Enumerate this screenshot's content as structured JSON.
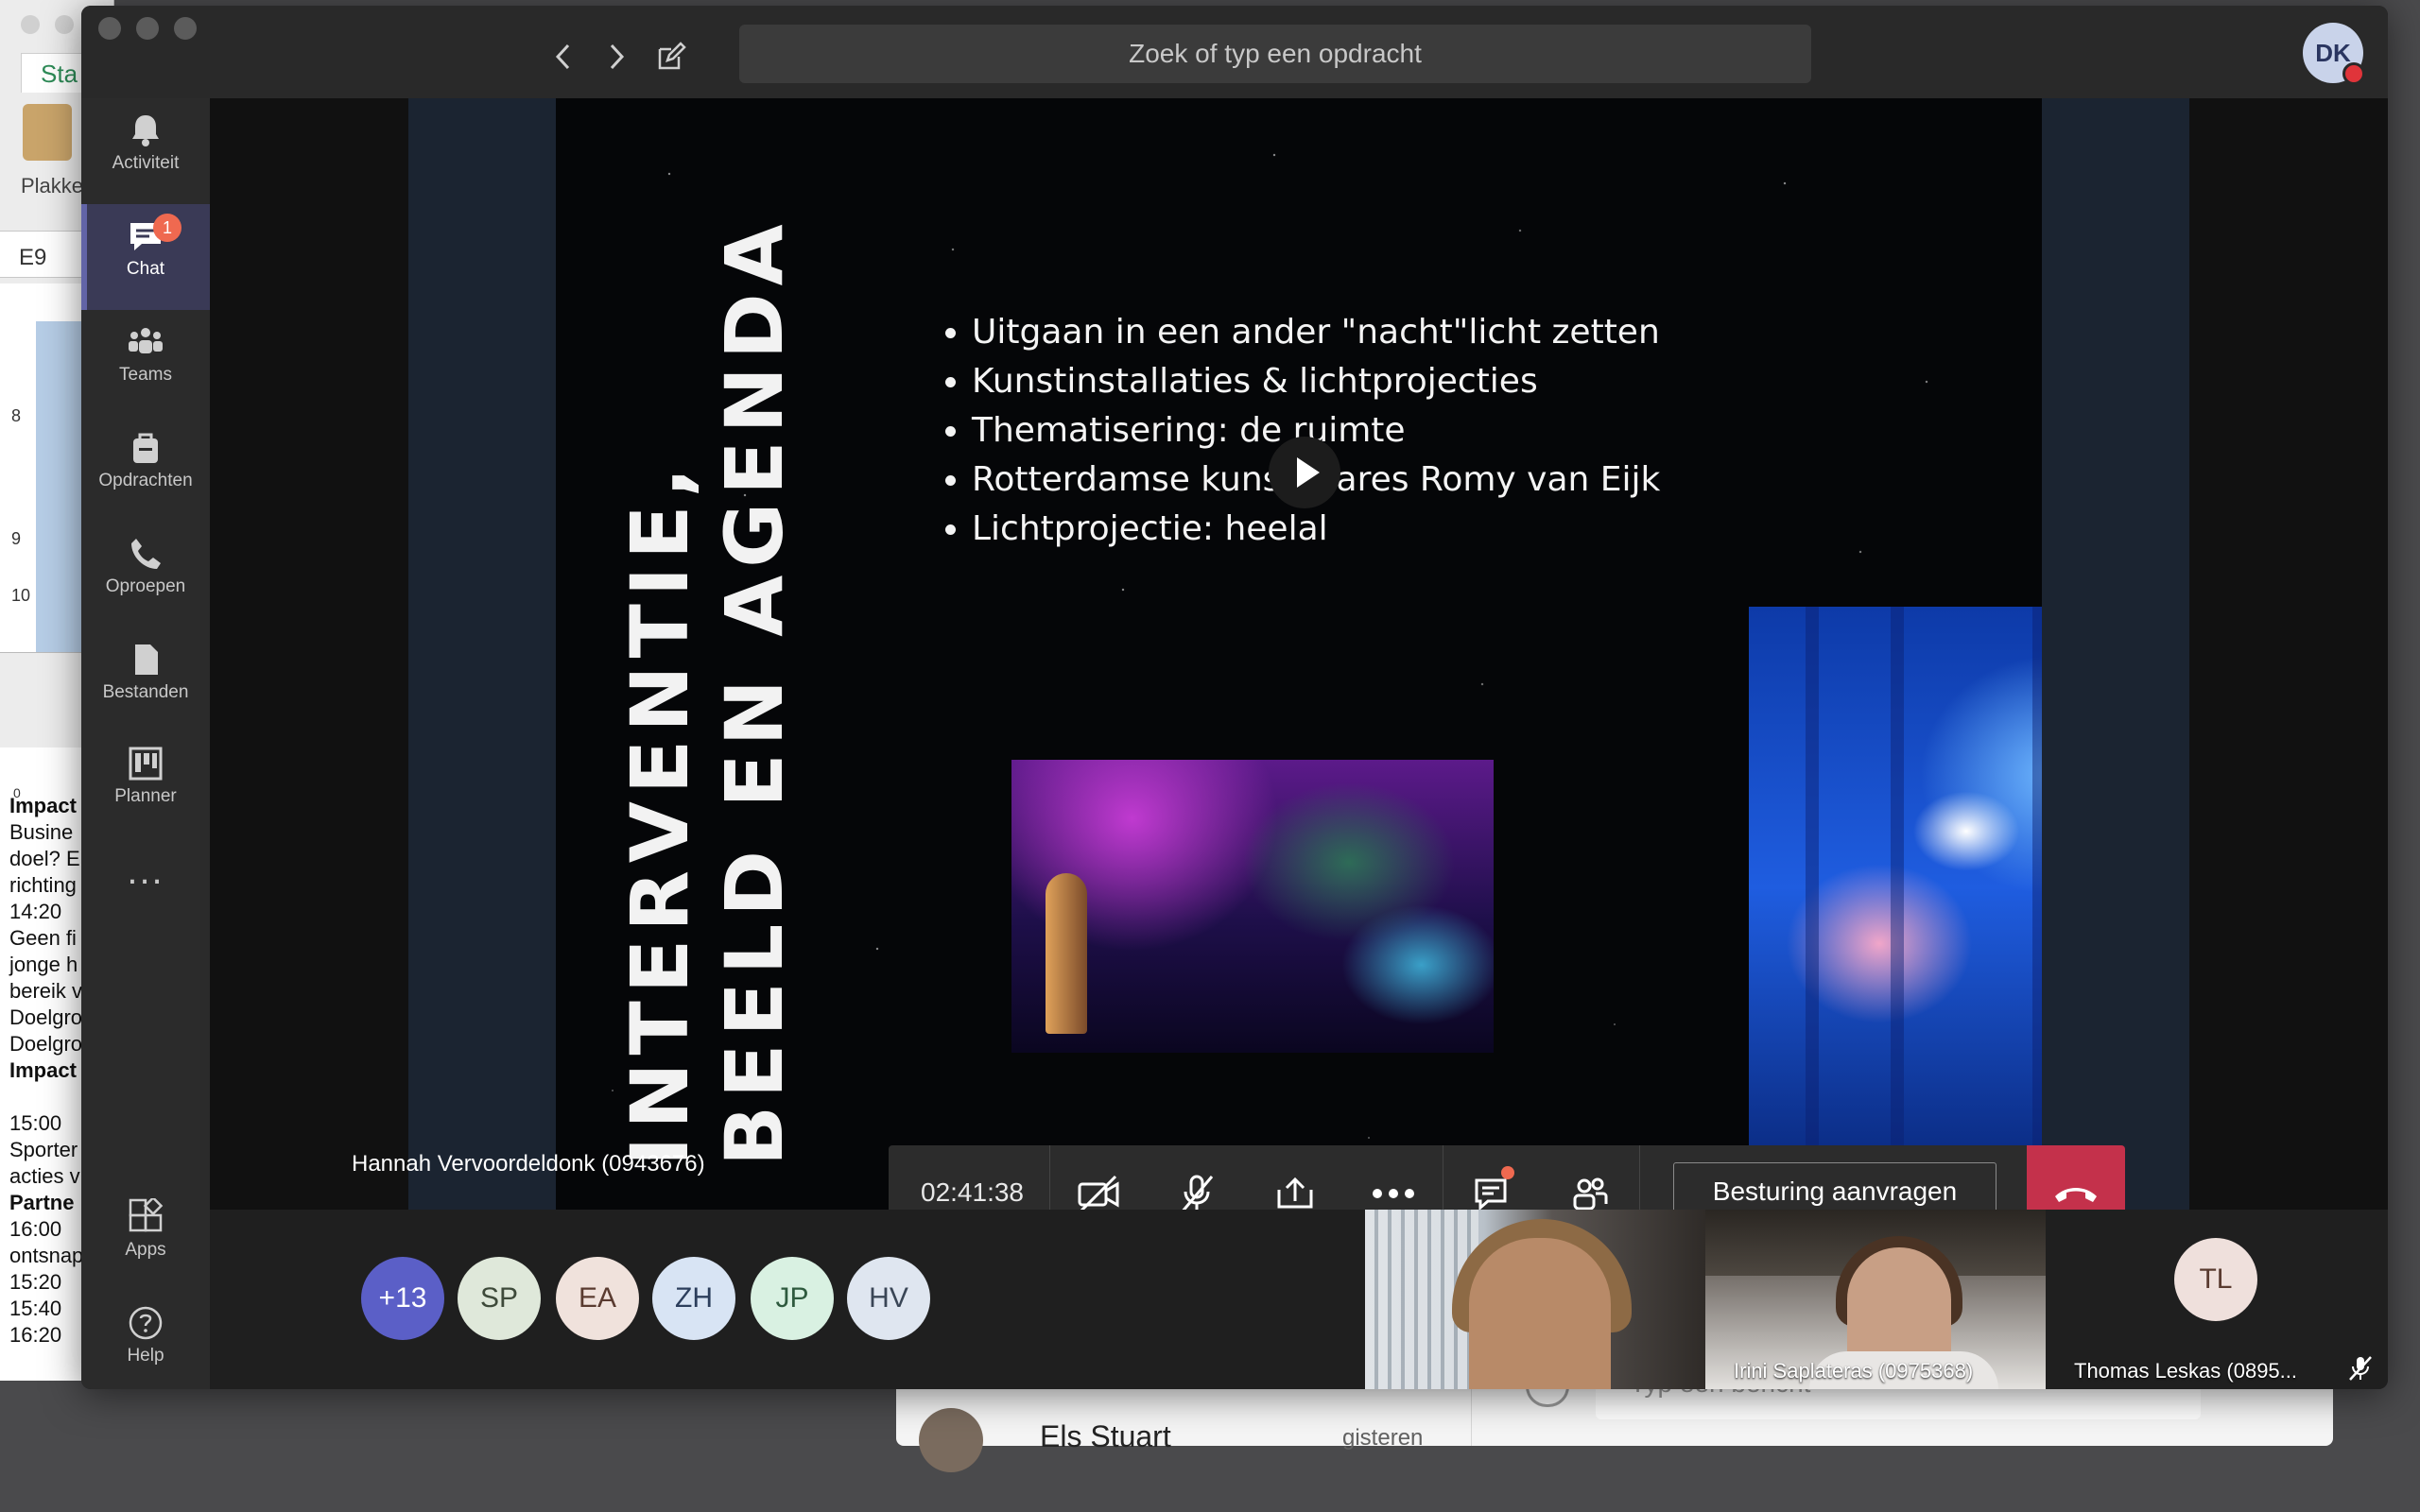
{
  "background": {
    "excel": {
      "tab_fragment": "Sta",
      "paste_label": "Plakke",
      "cell_ref": "E9",
      "row_numbers": [
        "8",
        "9",
        "10"
      ]
    },
    "word": {
      "ruler_zero": "0",
      "lines": [
        "Impact",
        "Busine",
        "doel? E",
        "richting",
        "14:20",
        "Geen fi",
        "jonge h",
        "bereik v",
        "Doelgro",
        "Doelgro",
        "Impact",
        "",
        "15:00",
        "Sporter",
        "acties v",
        "Partne",
        "16:00",
        "ontsnap",
        "15:20",
        "15:40",
        "16:20"
      ]
    },
    "chat": {
      "contact_name": "Els Stuart",
      "contact_time": "gisteren",
      "compose_placeholder": "Typ een bericht"
    }
  },
  "teams": {
    "search_placeholder": "Zoek of typ een opdracht",
    "user_initials": "DK",
    "nav": [
      {
        "label": "Activiteit",
        "icon": "bell-icon"
      },
      {
        "label": "Chat",
        "icon": "chat-icon",
        "badge": "1"
      },
      {
        "label": "Teams",
        "icon": "teams-icon"
      },
      {
        "label": "Opdrachten",
        "icon": "assignments-icon"
      },
      {
        "label": "Oproepen",
        "icon": "phone-icon"
      },
      {
        "label": "Bestanden",
        "icon": "file-icon"
      },
      {
        "label": "Planner",
        "icon": "planner-icon"
      },
      {
        "label": "...",
        "icon": "more-icon"
      }
    ],
    "bottom_nav": [
      {
        "label": "Apps",
        "icon": "apps-icon"
      },
      {
        "label": "Help",
        "icon": "help-icon"
      }
    ],
    "slide": {
      "vertical_title_1": "INTERVENTIE,",
      "vertical_title_2": "BEELD EN AGENDA",
      "bullets": [
        "Uitgaan in een ander \"nacht\"licht zetten",
        "Kunstinstallaties & lichtprojecties",
        "Thematisering: de ruimte",
        "Rotterdamse kunstenares Romy van Eijk",
        "Lichtprojectie: heelal"
      ]
    },
    "presenter_name": "Hannah Vervoordeldonk (0943676)",
    "call": {
      "timer": "02:41:38",
      "request_control_label": "Besturing aanvragen"
    },
    "participants": {
      "overflow": {
        "label": "+13",
        "color": "#5b5fc7"
      },
      "avatars": [
        {
          "initials": "SP",
          "bg": "#dfe8da",
          "fg": "#3e4a3a"
        },
        {
          "initials": "EA",
          "bg": "#f0e2dc",
          "fg": "#5a3b30"
        },
        {
          "initials": "ZH",
          "bg": "#d8e4f4",
          "fg": "#2c3e5c"
        },
        {
          "initials": "JP",
          "bg": "#d9f1e2",
          "fg": "#2e5a3e"
        },
        {
          "initials": "HV",
          "bg": "#dfe6f0",
          "fg": "#3a4656"
        }
      ],
      "video_tiles": [
        {
          "name": ""
        },
        {
          "name": "Irini Saplateras (0975368)"
        }
      ],
      "muted_tile": {
        "initials": "TL",
        "name": "Thomas Leskas (0895...",
        "bg": "#efe0dc",
        "fg": "#5a3b30"
      }
    }
  }
}
